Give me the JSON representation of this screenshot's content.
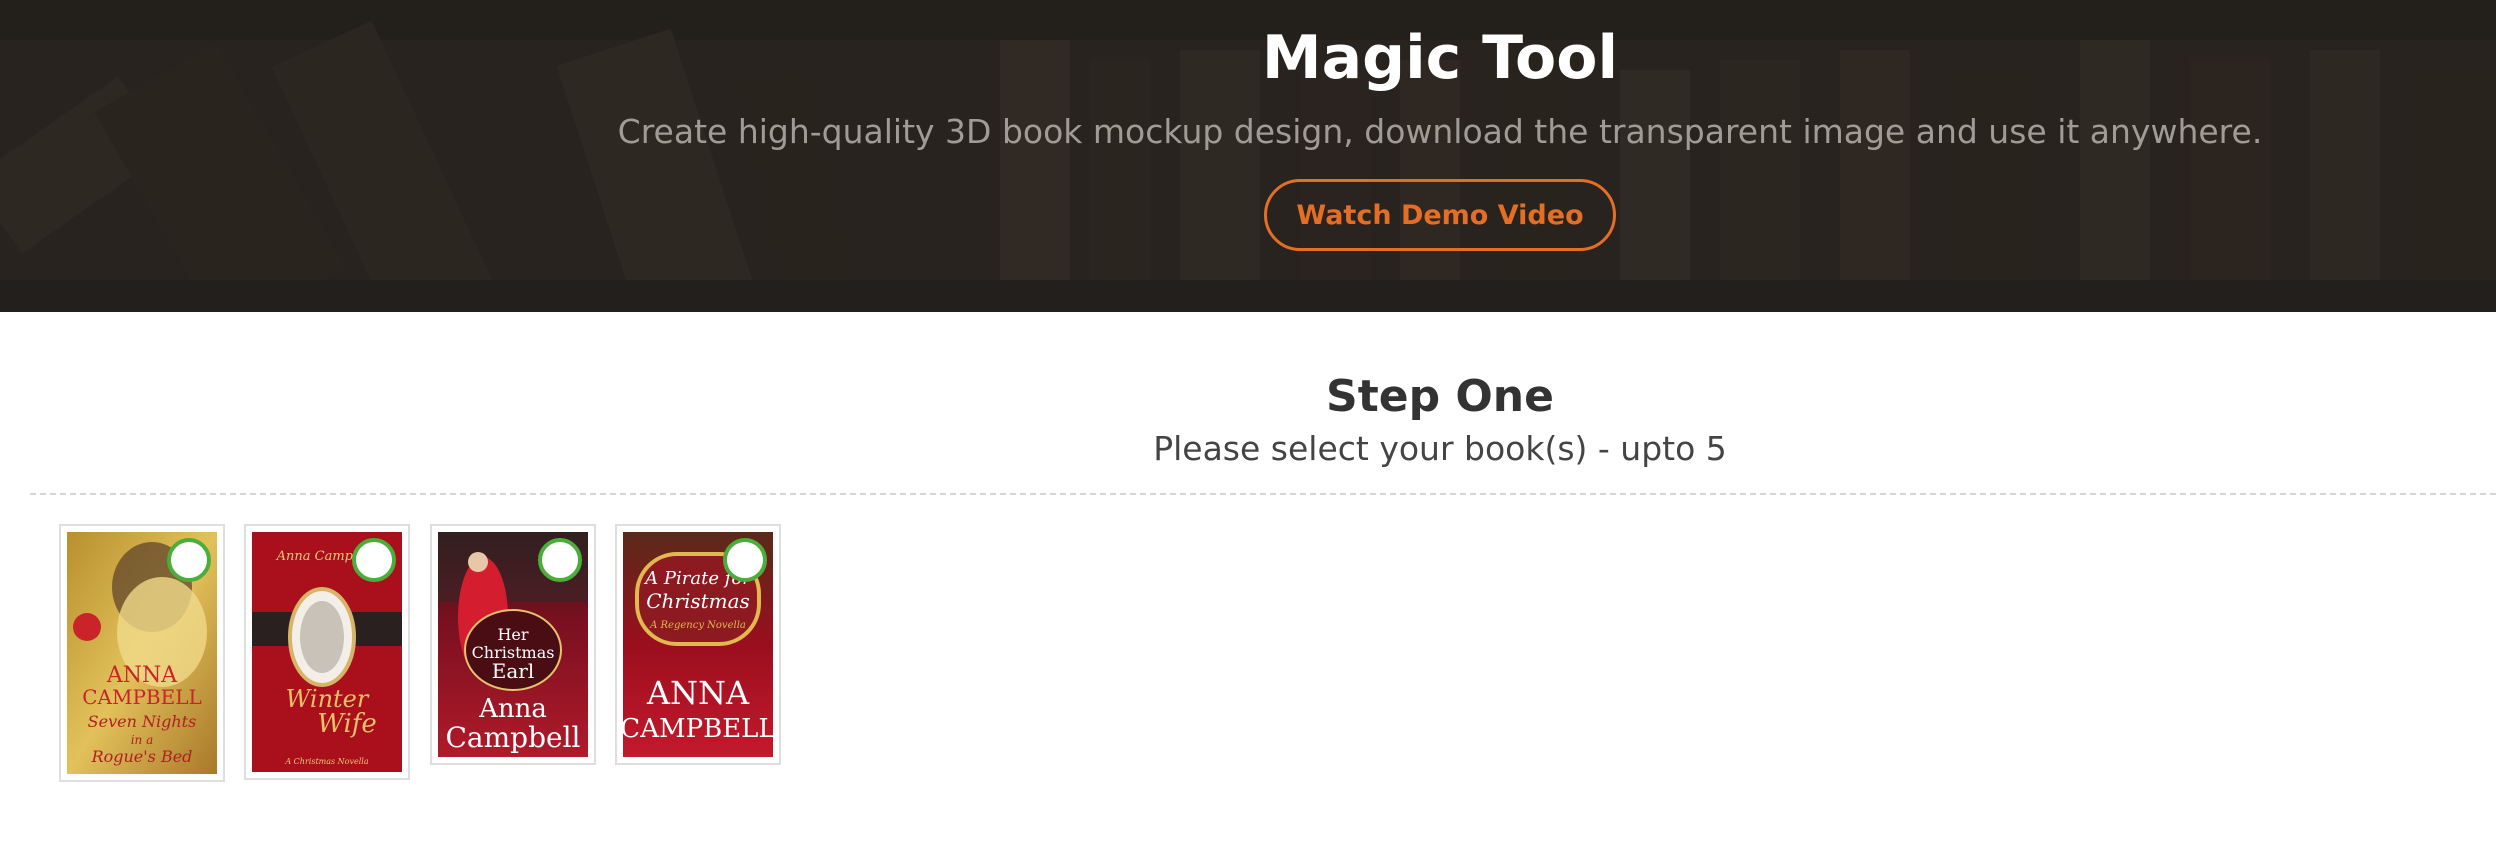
{
  "hero": {
    "title": "Magic Tool",
    "subtitle": "Create high-quality 3D book mockup design, download the transparent image and use it anywhere.",
    "demo_button_label": "Watch Demo Video",
    "accent_color": "#e36e26"
  },
  "step": {
    "title": "Step One",
    "subtitle": "Please select your book(s) - upto 5"
  },
  "books": [
    {
      "author": "ANNA CAMPBELL",
      "title": "Seven Nights in a Rogue's Bed",
      "selected": false
    },
    {
      "author": "Anna Campbell",
      "title": "The Winter Wife",
      "series": "A Christmas Novella",
      "selected": false
    },
    {
      "author": "Anna Campbell",
      "title": "Her Christmas Earl",
      "selected": false
    },
    {
      "author": "ANNA CAMPBELL",
      "title": "A Pirate for Christmas",
      "series": "A Regency Novella",
      "selected": false
    }
  ],
  "selection_indicator_color": "#4cae3a"
}
